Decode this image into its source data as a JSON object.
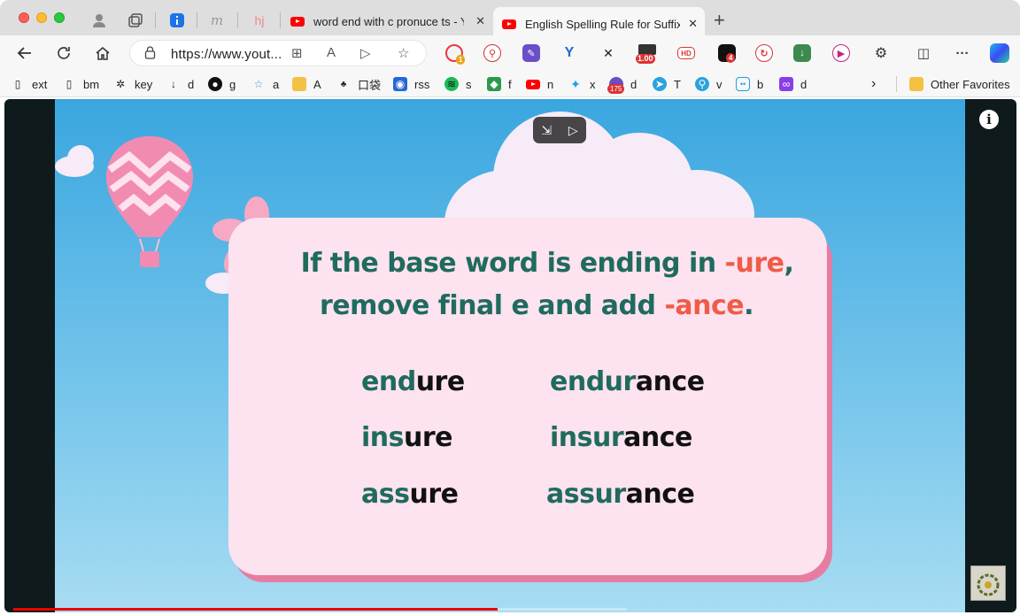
{
  "tabs": [
    {
      "title": "word end with c pronuce ts - Y"
    },
    {
      "title": "English Spelling Rule for Suffix"
    }
  ],
  "address": {
    "url": "https://www.yout..."
  },
  "extensions": {
    "speed_badge": "1.00",
    "hd_label": "HD",
    "badge_1": "1",
    "badge_4": "4"
  },
  "bookmarks": [
    {
      "label": "ext"
    },
    {
      "label": "bm"
    },
    {
      "label": "key"
    },
    {
      "label": "d"
    },
    {
      "label": "g"
    },
    {
      "label": "a"
    },
    {
      "label": "A"
    },
    {
      "label": "口袋"
    },
    {
      "label": "rss"
    },
    {
      "label": "s"
    },
    {
      "label": "f"
    },
    {
      "label": "n"
    },
    {
      "label": "x"
    },
    {
      "label": "d"
    },
    {
      "label": "T"
    },
    {
      "label": "v"
    },
    {
      "label": "b"
    },
    {
      "label": "d"
    }
  ],
  "bookmark_badge_175": "175",
  "other_favorites": "Other Favorites",
  "video": {
    "heading_line1_pre": "If the base word is ending in ",
    "heading_line1_hi": "-ure",
    "heading_line1_post": ",",
    "heading_line2_pre": "remove final e and add ",
    "heading_line2_hi": "-ance",
    "heading_line2_post": ".",
    "words": [
      {
        "base_a": "end",
        "base_b": "ure",
        "derived_a": "endur",
        "derived_b": "ance"
      },
      {
        "base_a": "ins",
        "base_b": "ure",
        "derived_a": "insur",
        "derived_b": "ance"
      },
      {
        "base_a": "ass",
        "base_b": "ure",
        "derived_a": "assur",
        "derived_b": "ance"
      }
    ],
    "progress_fraction": 0.79
  },
  "colors": {
    "accent_text": "#1f6b5e",
    "highlight": "#ef5c47",
    "card": "#fde2ef",
    "youtube_red": "#ff0000"
  }
}
